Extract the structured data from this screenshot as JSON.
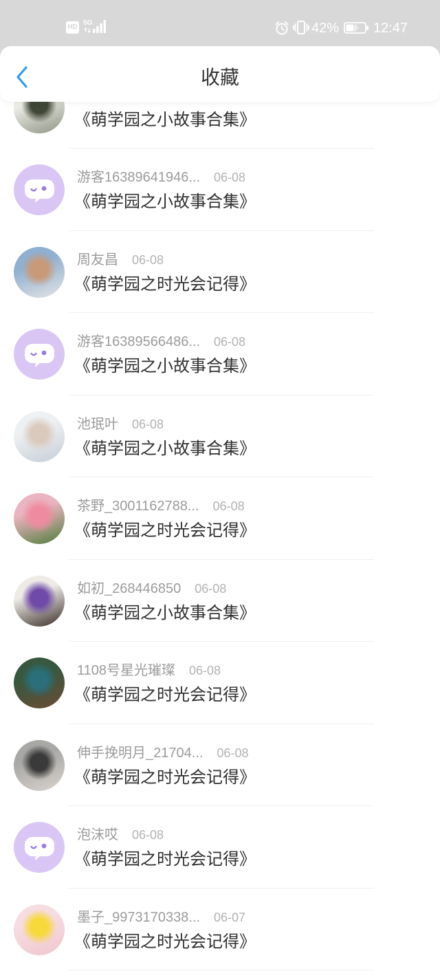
{
  "colors": {
    "accent": "#2e9bf0",
    "status_bar_bg": "#d8d8d8",
    "default_avatar_bg": "#d9c6f5",
    "default_avatar_mark": "#9b7ae0"
  },
  "status_bar": {
    "hd_label": "HD",
    "network_label": "5G",
    "battery_percent": "42%",
    "time": "12:47",
    "icons": [
      "signal-icon",
      "alarm-icon",
      "vibrate-icon",
      "battery-charging-icon"
    ]
  },
  "header": {
    "title": "收藏",
    "back_icon": "chevron-left-icon"
  },
  "favorites": [
    {
      "title": "《萌学园之小故事合集》",
      "avatar_colors": [
        "#efefe9",
        "#414737",
        "#8e9483"
      ]
    },
    {
      "user": "游客16389641946...",
      "date": "06-08",
      "title": "《萌学园之小故事合集》",
      "avatar_icon": "default-avatar-icon"
    },
    {
      "user": "周友昌",
      "date": "06-08",
      "title": "《萌学园之时光会记得》",
      "avatar_colors": [
        "#8fb0d0",
        "#c89a78",
        "#e4e4e4"
      ]
    },
    {
      "user": "游客16389566486...",
      "date": "06-08",
      "title": "《萌学园之小故事合集》",
      "avatar_icon": "default-avatar-icon"
    },
    {
      "user": "池珉叶",
      "date": "06-08",
      "title": "《萌学园之小故事合集》",
      "avatar_colors": [
        "#eef1f3",
        "#dacabe",
        "#c5ced6"
      ]
    },
    {
      "user": "茶野_3001162788...",
      "date": "06-08",
      "title": "《萌学园之时光会记得》",
      "avatar_colors": [
        "#eab4c0",
        "#ef8ba0",
        "#4f7d3b"
      ]
    },
    {
      "user": "如初_268446850",
      "date": "06-08",
      "title": "《萌学园之小故事合集》",
      "avatar_colors": [
        "#eeebe7",
        "#6f4aa8",
        "#3b2d28"
      ]
    },
    {
      "user": "1108号星光璀璨",
      "date": "06-08",
      "title": "《萌学园之时光会记得》",
      "avatar_colors": [
        "#37583e",
        "#2a6f7a",
        "#6b4b35"
      ]
    },
    {
      "user": "伸手挽明月_21704...",
      "date": "06-08",
      "title": "《萌学园之时光会记得》",
      "avatar_colors": [
        "#a8a8a6",
        "#3b3a3a",
        "#d8d2cc"
      ]
    },
    {
      "user": "泡沫哎",
      "date": "06-08",
      "title": "《萌学园之时光会记得》",
      "avatar_icon": "default-avatar-icon"
    },
    {
      "user": "墨子_9973170338...",
      "date": "06-07",
      "title": "《萌学园之时光会记得》",
      "avatar_colors": [
        "#f6dde2",
        "#f7d93c",
        "#f0c6cd"
      ]
    }
  ]
}
